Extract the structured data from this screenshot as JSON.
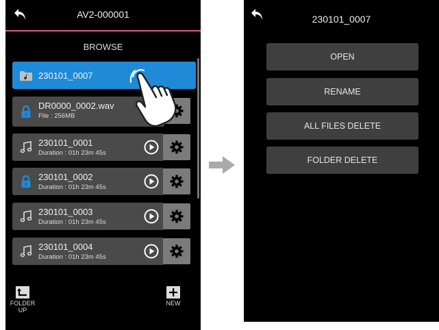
{
  "left_screen": {
    "title": "AV2-000001",
    "section": "BROWSE",
    "items": [
      {
        "name": "230101_0007",
        "sub": "",
        "icon": "music-folder-icon",
        "selected": true
      },
      {
        "name": "DR0000_0002.wav",
        "sub": "File : 256MB",
        "icon": "lock-icon"
      },
      {
        "name": "230101_0001",
        "sub": "Duration : 01h 23m 45s",
        "icon": "music-note-icon"
      },
      {
        "name": "230101_0002",
        "sub": "Duration : 01h 23m 45s",
        "icon": "lock-icon"
      },
      {
        "name": "230101_0003",
        "sub": "Duration : 01h 23m 45s",
        "icon": "music-note-icon"
      },
      {
        "name": "230101_0004",
        "sub": "Duration : 01h 23m 45s",
        "icon": "music-note-icon"
      }
    ],
    "folder_up_label": "FOLDER UP",
    "new_label": "NEW"
  },
  "right_screen": {
    "title": "230101_0007",
    "menu": [
      {
        "label": "OPEN"
      },
      {
        "label": "RENAME"
      },
      {
        "label": "ALL FILES DELETE"
      },
      {
        "label": "FOLDER DELETE"
      }
    ]
  },
  "colors": {
    "accent_pink": "#e0578a",
    "selected_blue": "#1f8bd8",
    "row_gray": "#4a4a4a",
    "button_gray": "#7b7b7b"
  }
}
